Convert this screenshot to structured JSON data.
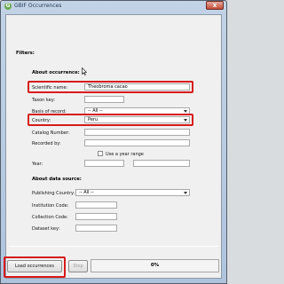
{
  "window": {
    "title": "GBIF Occurrences",
    "icon": "gbif-app-icon",
    "icon_glyph": "G",
    "close_glyph": "x"
  },
  "filters_heading": "Filters:",
  "occurrence": {
    "heading": "About occurrence:",
    "scientific_name_label": "Scientific name:",
    "scientific_name_value": "Theobroma cacao",
    "taxon_key_label": "Taxon key:",
    "taxon_key_value": "",
    "basis_label": "Basis of record:",
    "basis_value": "-- All --",
    "country_label": "Country:",
    "country_value": "Peru",
    "catalog_label": "Catalog Number:",
    "catalog_value": "",
    "recorded_label": "Recorded by:",
    "recorded_value": "",
    "year_label": "Year:",
    "year_range_label": "Use a year range",
    "year_value": "",
    "year_to_value": ""
  },
  "data_source": {
    "heading": "About data source:",
    "publishing_country_label": "Publishing Country:",
    "publishing_country_value": "-- All --",
    "institution_label": "Institution Code:",
    "institution_value": "",
    "collection_label": "Collection Code:",
    "collection_value": "",
    "dataset_label": "Dataset key:",
    "dataset_value": ""
  },
  "actions": {
    "load_label": "Load occurrences",
    "stop_label": "Stop",
    "progress_text": "0%",
    "progress_value": 0
  },
  "colors": {
    "highlight": "#d81b1b"
  }
}
